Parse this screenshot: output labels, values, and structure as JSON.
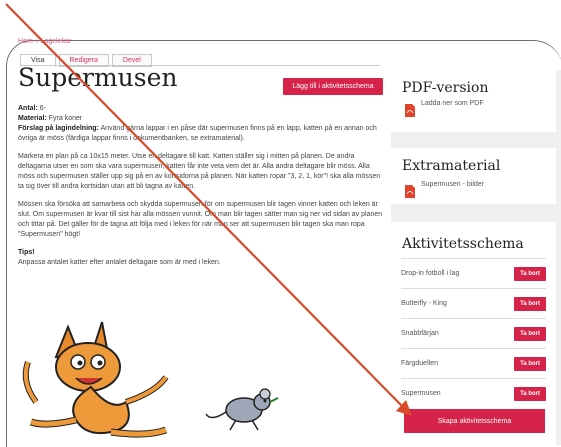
{
  "breadcrumb": "Hem » Lagelekar",
  "tabs": [
    {
      "label": "Visa"
    },
    {
      "label": "Redigera"
    },
    {
      "label": "Devel"
    }
  ],
  "page_title": "Supermusen",
  "add_button": "Lägg till i aktivitetsschema",
  "meta": {
    "antal_label": "Antal:",
    "antal_value": "6-",
    "material_label": "Material:",
    "material_value": "Fyra koner",
    "forslag_label": "Förslag på lagindelning:",
    "forslag_value": "Använd gärna lappar i en påse där supermusen finns på en lapp, katten på en annan och övriga är möss (färdiga lappar finns i dokumentbanken, se extramaterial)."
  },
  "paragraphs": [
    "Markera en plan på ca 10x15 meter. Utse en deltagare till katt. Katten ställer sig i mitten på planen. De andra deltagarna utser en som ska vara supermusen, katten får inte veta vem det är. Alla andra deltagare blir möss. Alla möss och supermusen ställer upp sig på en av kortsidorna på planen. När katten ropar \"3, 2, 1, kör\"! ska alla mössen ta sig över till andra kortsidan utan att bli tagna av katten.",
    "Mössen ska försöka att samarbeta och skydda supermusen för om supermusen blir tagen vinner katten och leken är slut. Om supermusen är kvar till sist har alla mössen vunnit. Om man blir tagen sätter man sig ner vid sidan av planen och tittar på. Det gäller för de tagna att följa med i leken för när man ser att supermusen blir tagen ska man ropa \"Supermusen\" högt!"
  ],
  "tips_label": "Tips!",
  "tips_text": "Anpassa antalet katter efter antalet deltagare som är med i leken.",
  "pdf": {
    "heading": "PDF-version",
    "link": "Ladda ner som PDF"
  },
  "extra": {
    "heading": "Extramaterial",
    "link": "Supermusen - bilder"
  },
  "schedule": {
    "heading": "Aktivitetsschema",
    "delete_label": "Ta bort",
    "items": [
      "Drop-in fotboll i lag",
      "Butterfly - King",
      "Snabbfärjan",
      "Färgduellen",
      "Supermusen"
    ],
    "create_button": "Skapa aktivitetsschema"
  },
  "colors": {
    "accent": "#d6234a",
    "arrow": "#d94a2a",
    "sidebar_bg": "#f0f0f0"
  }
}
